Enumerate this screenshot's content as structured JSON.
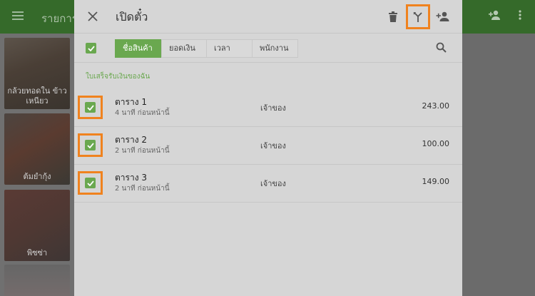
{
  "background": {
    "header_title": "รายการ",
    "cards": [
      {
        "label": "กล้วยทอดใน ข้าวเหนียว"
      },
      {
        "label": "ต้มยำกุ้ง"
      },
      {
        "label": "พิซซ่า"
      },
      {
        "label": ""
      }
    ]
  },
  "dialog": {
    "title": "เปิดตั๋ว",
    "tabs": [
      {
        "label": "ชื่อสินค้า",
        "active": true
      },
      {
        "label": "ยอดเงิน",
        "active": false
      },
      {
        "label": "เวลา",
        "active": false
      },
      {
        "label": "พนักงาน",
        "active": false
      }
    ],
    "section_label": "ใบเสร็จรับเงินของฉัน",
    "tickets": [
      {
        "name": "ตาราง 1",
        "time": "4 นาที ก่อนหน้านี้",
        "owner": "เจ้าของ",
        "amount": "243.00",
        "checked": true
      },
      {
        "name": "ตาราง 2",
        "time": "2 นาที ก่อนหน้านี้",
        "owner": "เจ้าของ",
        "amount": "100.00",
        "checked": true
      },
      {
        "name": "ตาราง 3",
        "time": "2 นาที ก่อนหน้านี้",
        "owner": "เจ้าของ",
        "amount": "149.00",
        "checked": true
      }
    ]
  },
  "colors": {
    "accent": "#6aa84f",
    "highlight": "#f0821e",
    "appbar": "#356a2a"
  },
  "icons": [
    "menu-icon",
    "close-icon",
    "trash-icon",
    "merge-icon",
    "person-add-icon",
    "search-icon",
    "more-vert-icon",
    "check-icon"
  ]
}
